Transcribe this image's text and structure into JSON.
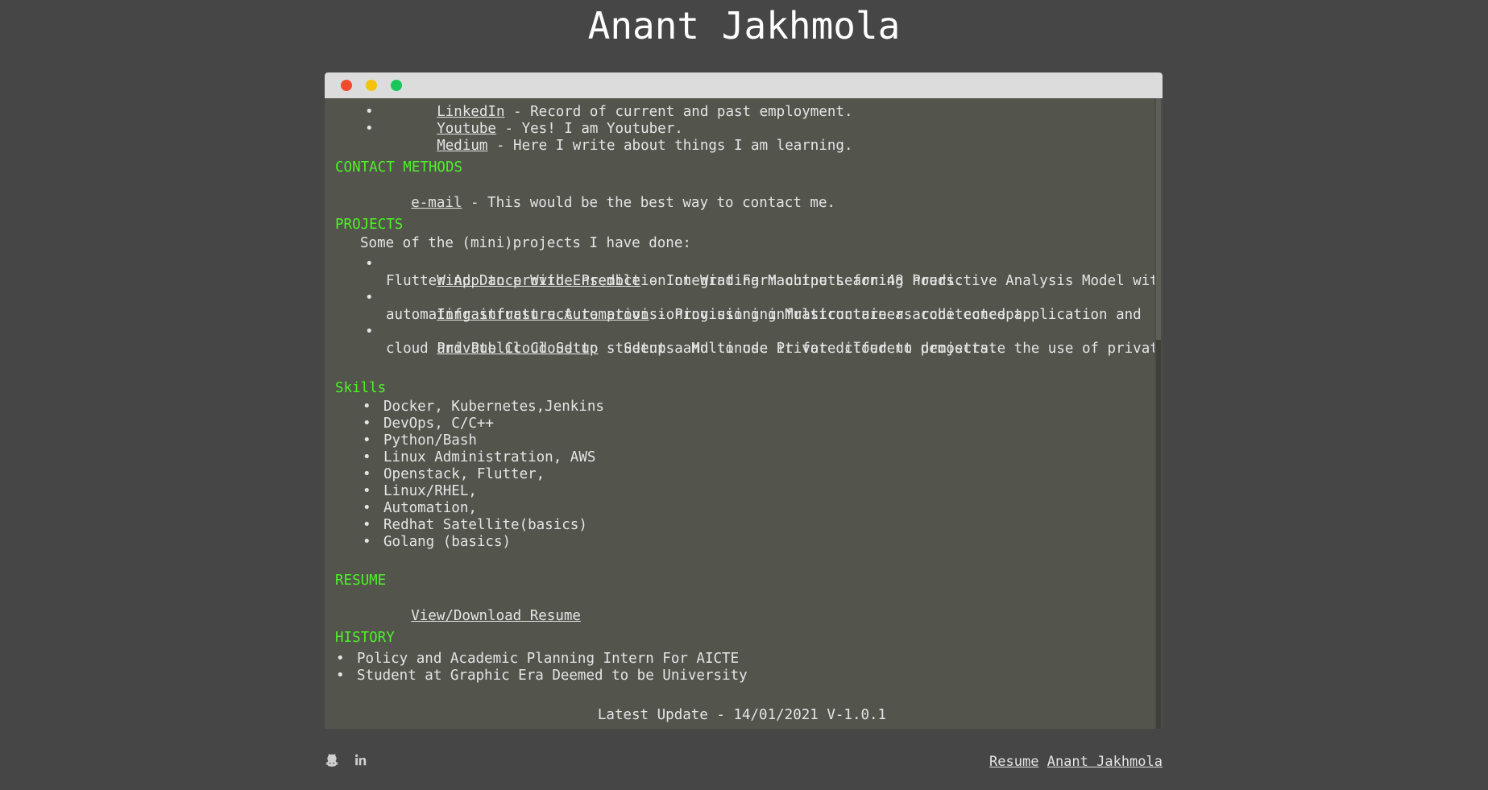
{
  "header": {
    "title": "Anant Jakhmola"
  },
  "window": {
    "buttons": [
      "close",
      "minimize",
      "maximize"
    ],
    "colors": {
      "close": "#f24a2c",
      "minimize": "#f4c20b",
      "maximize": "#17c75a"
    }
  },
  "social_partial": {
    "link": "LinkedIn",
    "desc": " - Record of current and past employment."
  },
  "social": [
    {
      "link": "Youtube",
      "desc": " - Yes! I am Youtuber."
    },
    {
      "link": "Medium",
      "desc": " - Here I write about things I am learning."
    }
  ],
  "contact": {
    "heading": "CONTACT METHODS",
    "link": "e-mail",
    "desc": " - This would be the best way to contact me."
  },
  "projects": {
    "heading": "PROJECTS",
    "intro": "Some of the (mini)projects I have done:",
    "items": [
      {
        "link": "Wind Dance With Ensemble",
        "line1": " - Integrating Machine Learning Predictive Analysis Model with",
        "line2": "Flutter App to provide Prediction on Wind Farm outputs for 48 hours."
      },
      {
        "link": "Infrastructure Automation",
        "line1": " - Provisioning Multicontainer architected application and",
        "line2": "automating infrastructure provisioning using infrastructure as code concept."
      },
      {
        "link": "Private Cloud Setup",
        "line1": " - Setup a Multinode Private cloud to demostrate the use of private",
        "line2": "cloud and Public Cloud to students and to use it for different projects."
      }
    ]
  },
  "skills": {
    "heading": "Skills",
    "items": [
      "Docker, Kubernetes,Jenkins",
      "DevOps, C/C++",
      "Python/Bash",
      "Linux Administration, AWS",
      "Openstack, Flutter,",
      "Linux/RHEL,",
      "Automation,",
      "Redhat Satellite(basics)",
      "Golang (basics)"
    ]
  },
  "resume": {
    "heading": "RESUME",
    "link": "View/Download Resume"
  },
  "history": {
    "heading": "HISTORY",
    "items": [
      "Policy and Academic Planning Intern For AICTE",
      "Student at Graphic Era Deemed to be University"
    ]
  },
  "update": "Latest Update - 14/01/2021 V-1.0.1",
  "footer": {
    "icons": [
      "github-icon",
      "linkedin-icon"
    ],
    "resume_link": "Resume",
    "name_link": "Anant Jakhmola"
  }
}
